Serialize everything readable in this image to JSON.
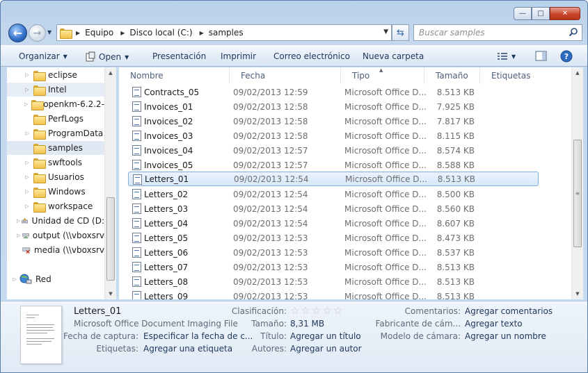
{
  "window": {
    "caption_buttons": {
      "minimize": "—",
      "maximize": "□",
      "close": "✕"
    }
  },
  "address": {
    "crumbs": [
      "Equipo",
      "Disco local (C:)",
      "samples"
    ]
  },
  "search": {
    "placeholder": "Buscar samples"
  },
  "toolbar": {
    "organize": "Organizar",
    "open": "Open",
    "slideshow": "Presentación",
    "print": "Imprimir",
    "email": "Correo electrónico",
    "new_folder": "Nueva carpeta"
  },
  "nav_pane": {
    "items": [
      {
        "label": "eclipse"
      },
      {
        "label": "Intel"
      },
      {
        "label": "openkm-6.2.2-"
      },
      {
        "label": "PerfLogs"
      },
      {
        "label": "ProgramData"
      },
      {
        "label": "samples"
      },
      {
        "label": "swftools"
      },
      {
        "label": "Usuarios"
      },
      {
        "label": "Windows"
      },
      {
        "label": "workspace"
      },
      {
        "label": "Unidad de CD (D:"
      },
      {
        "label": "output (\\\\vboxsrv"
      },
      {
        "label": "media (\\\\vboxsrv"
      },
      {
        "label": "Red"
      }
    ]
  },
  "columns": {
    "name": "Nombre",
    "date": "Fecha",
    "type": "Tipo",
    "size": "Tamaño",
    "tags": "Etiquetas"
  },
  "files": [
    {
      "name": "Contracts_05",
      "date": "09/02/2013 12:59",
      "type": "Microsoft Office D...",
      "size": "8.513 KB"
    },
    {
      "name": "Invoices_01",
      "date": "09/02/2013 12:58",
      "type": "Microsoft Office D...",
      "size": "7.925 KB"
    },
    {
      "name": "Invoices_02",
      "date": "09/02/2013 12:58",
      "type": "Microsoft Office D...",
      "size": "7.817 KB"
    },
    {
      "name": "Invoices_03",
      "date": "09/02/2013 12:58",
      "type": "Microsoft Office D...",
      "size": "8.115 KB"
    },
    {
      "name": "Invoices_04",
      "date": "09/02/2013 12:57",
      "type": "Microsoft Office D...",
      "size": "8.574 KB"
    },
    {
      "name": "Invoices_05",
      "date": "09/02/2013 12:57",
      "type": "Microsoft Office D...",
      "size": "8.588 KB"
    },
    {
      "name": "Letters_01",
      "date": "09/02/2013 12:54",
      "type": "Microsoft Office D...",
      "size": "8.513 KB"
    },
    {
      "name": "Letters_02",
      "date": "09/02/2013 12:54",
      "type": "Microsoft Office D...",
      "size": "8.500 KB"
    },
    {
      "name": "Letters_03",
      "date": "09/02/2013 12:54",
      "type": "Microsoft Office D...",
      "size": "8.560 KB"
    },
    {
      "name": "Letters_04",
      "date": "09/02/2013 12:54",
      "type": "Microsoft Office D...",
      "size": "8.607 KB"
    },
    {
      "name": "Letters_05",
      "date": "09/02/2013 12:53",
      "type": "Microsoft Office D...",
      "size": "8.473 KB"
    },
    {
      "name": "Letters_06",
      "date": "09/02/2013 12:53",
      "type": "Microsoft Office D...",
      "size": "8.537 KB"
    },
    {
      "name": "Letters_07",
      "date": "09/02/2013 12:53",
      "type": "Microsoft Office D...",
      "size": "8.513 KB"
    },
    {
      "name": "Letters_08",
      "date": "09/02/2013 12:53",
      "type": "Microsoft Office D...",
      "size": "8.513 KB"
    },
    {
      "name": "Letters_09",
      "date": "09/02/2013 12:53",
      "type": "Microsoft Office D...",
      "size": "8.513 KB"
    }
  ],
  "selected_file": "Letters_01",
  "details": {
    "title": "Letters_01",
    "subtitle": "Microsoft Office Document Imaging File",
    "capture_date_label": "Fecha de captura:",
    "capture_date_value": "Especificar la fecha de c...",
    "tags_label": "Etiquetas:",
    "tags_value": "Agregar una etiqueta",
    "rating_label": "Clasificación:",
    "rating_stars": 0,
    "size_label": "Tamaño:",
    "size_value": "8,31 MB",
    "title_label": "Título:",
    "title_value": "Agregar un título",
    "authors_label": "Autores:",
    "authors_value": "Agregar un autor",
    "comments_label": "Comentarios:",
    "comments_value": "Agregar comentarios",
    "maker_label": "Fabricante de cám...",
    "maker_value": "Agregar texto",
    "model_label": "Modelo de cámara:",
    "model_value": "Agregar un nombre"
  },
  "colors": {
    "accent": "#2c66a9",
    "selection_bg": "#d7e8fb",
    "selection_border": "#84acdd"
  }
}
